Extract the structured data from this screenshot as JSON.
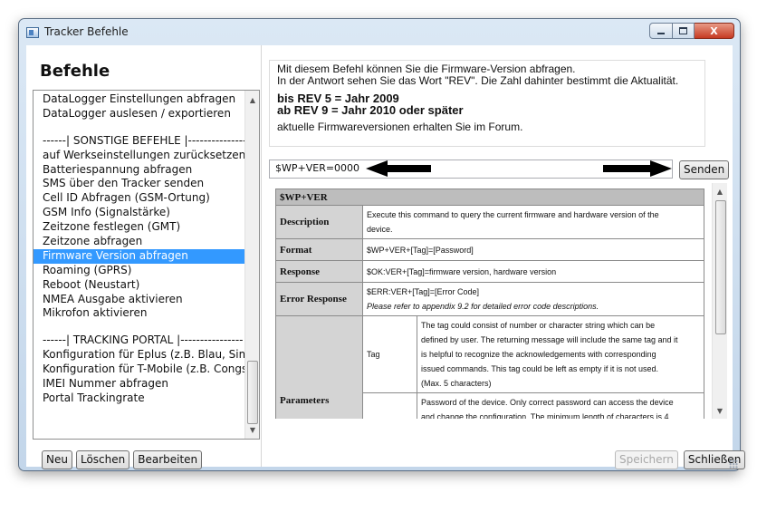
{
  "window": {
    "title": "Tracker Befehle",
    "close_glyph": "X"
  },
  "left": {
    "heading": "Befehle",
    "items": [
      "DataLogger Einstellungen abfragen",
      "DataLogger auslesen / exportieren",
      "",
      "------| SONSTIGE BEFEHLE |----------------",
      "auf Werkseinstellungen zurücksetzen",
      "Batteriespannung abfragen",
      "SMS über den Tracker senden",
      "Cell ID Abfragen (GSM-Ortung)",
      "GSM Info (Signalstärke)",
      "Zeitzone festlegen (GMT)",
      "Zeitzone abfragen",
      "Firmware Version abfragen",
      "Roaming (GPRS)",
      "Reboot (Neustart)",
      "NMEA Ausgabe aktivieren",
      "Mikrofon aktivieren",
      "",
      "------| TRACKING PORTAL |----------------",
      "Konfiguration für Eplus (z.B. Blau, Simyo)",
      "Konfiguration für T-Mobile (z.B. Congstar)",
      "IMEI Nummer abfragen",
      "Portal Trackingrate"
    ],
    "selected_index": 11,
    "buttons": {
      "new": "Neu",
      "delete": "Löschen",
      "edit": "Bearbeiten"
    }
  },
  "info": {
    "line1": "Mit diesem Befehl können Sie die Firmware-Version abfragen.",
    "line2": "In der Antwort sehen Sie das Wort \"REV\". Die Zahl dahinter bestimmt die Aktualität.",
    "bold1": "bis REV 5 = Jahr 2009",
    "bold2": "ab REV 9 = Jahr 2010 oder später",
    "line3": "aktuelle Firmwareversionen erhalten Sie im Forum."
  },
  "command": {
    "value": "$WP+VER=0000",
    "send_label": "Senden"
  },
  "doc": {
    "header": "$WP+VER",
    "description_label": "Description",
    "description_line1": "Execute this command to query the current firmware and hardware version of the",
    "description_line2": "device.",
    "format_label": "Format",
    "format_value": "$WP+VER+[Tag]=[Password]",
    "response_label": "Response",
    "response_value": "$OK:VER+[Tag]=firmware version, hardware version",
    "error_label": "Error Response",
    "error_value": "$ERR:VER+[Tag]=[Error Code]",
    "error_note": "Please refer to appendix 9.2 for detailed error code descriptions.",
    "parameters_label": "Parameters",
    "tag_label": "Tag",
    "tag_lines": [
      "The tag could consist of number or character string which can be",
      "defined by user. The returning message will include the same tag and it",
      "is helpful to recognize the acknowledgements with corresponding",
      "issued commands. This tag could be left as empty if it is not used.",
      "(Max. 5 characters)"
    ],
    "password_lines": [
      "Password of the device. Only correct password can access the device",
      "and change the configuration. The minimum length of characters is 4"
    ]
  },
  "right_buttons": {
    "save": "Speichern",
    "close": "Schließen"
  }
}
